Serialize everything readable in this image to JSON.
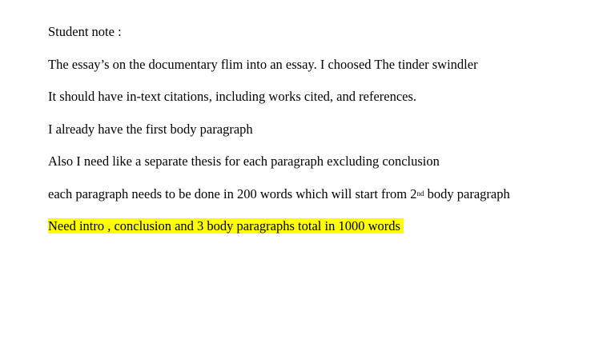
{
  "note": {
    "heading": "Student note :",
    "lines": [
      "The essay’s on the documentary flim into an essay. I choosed The tinder swindler",
      "It should have in-text citations, including works cited, and references.",
      "I already have the first body paragraph",
      "Also I need like a separate thesis for each paragraph excluding conclusion"
    ],
    "paragraph_line": {
      "before": "each paragraph needs to be done in 200 words which will start from 2",
      "superscript": "nd",
      "after": " body paragraph"
    },
    "highlighted_line": "Need intro , conclusion and 3 body paragraphs total in 1000 words",
    "highlight_color": "#ffff00"
  }
}
